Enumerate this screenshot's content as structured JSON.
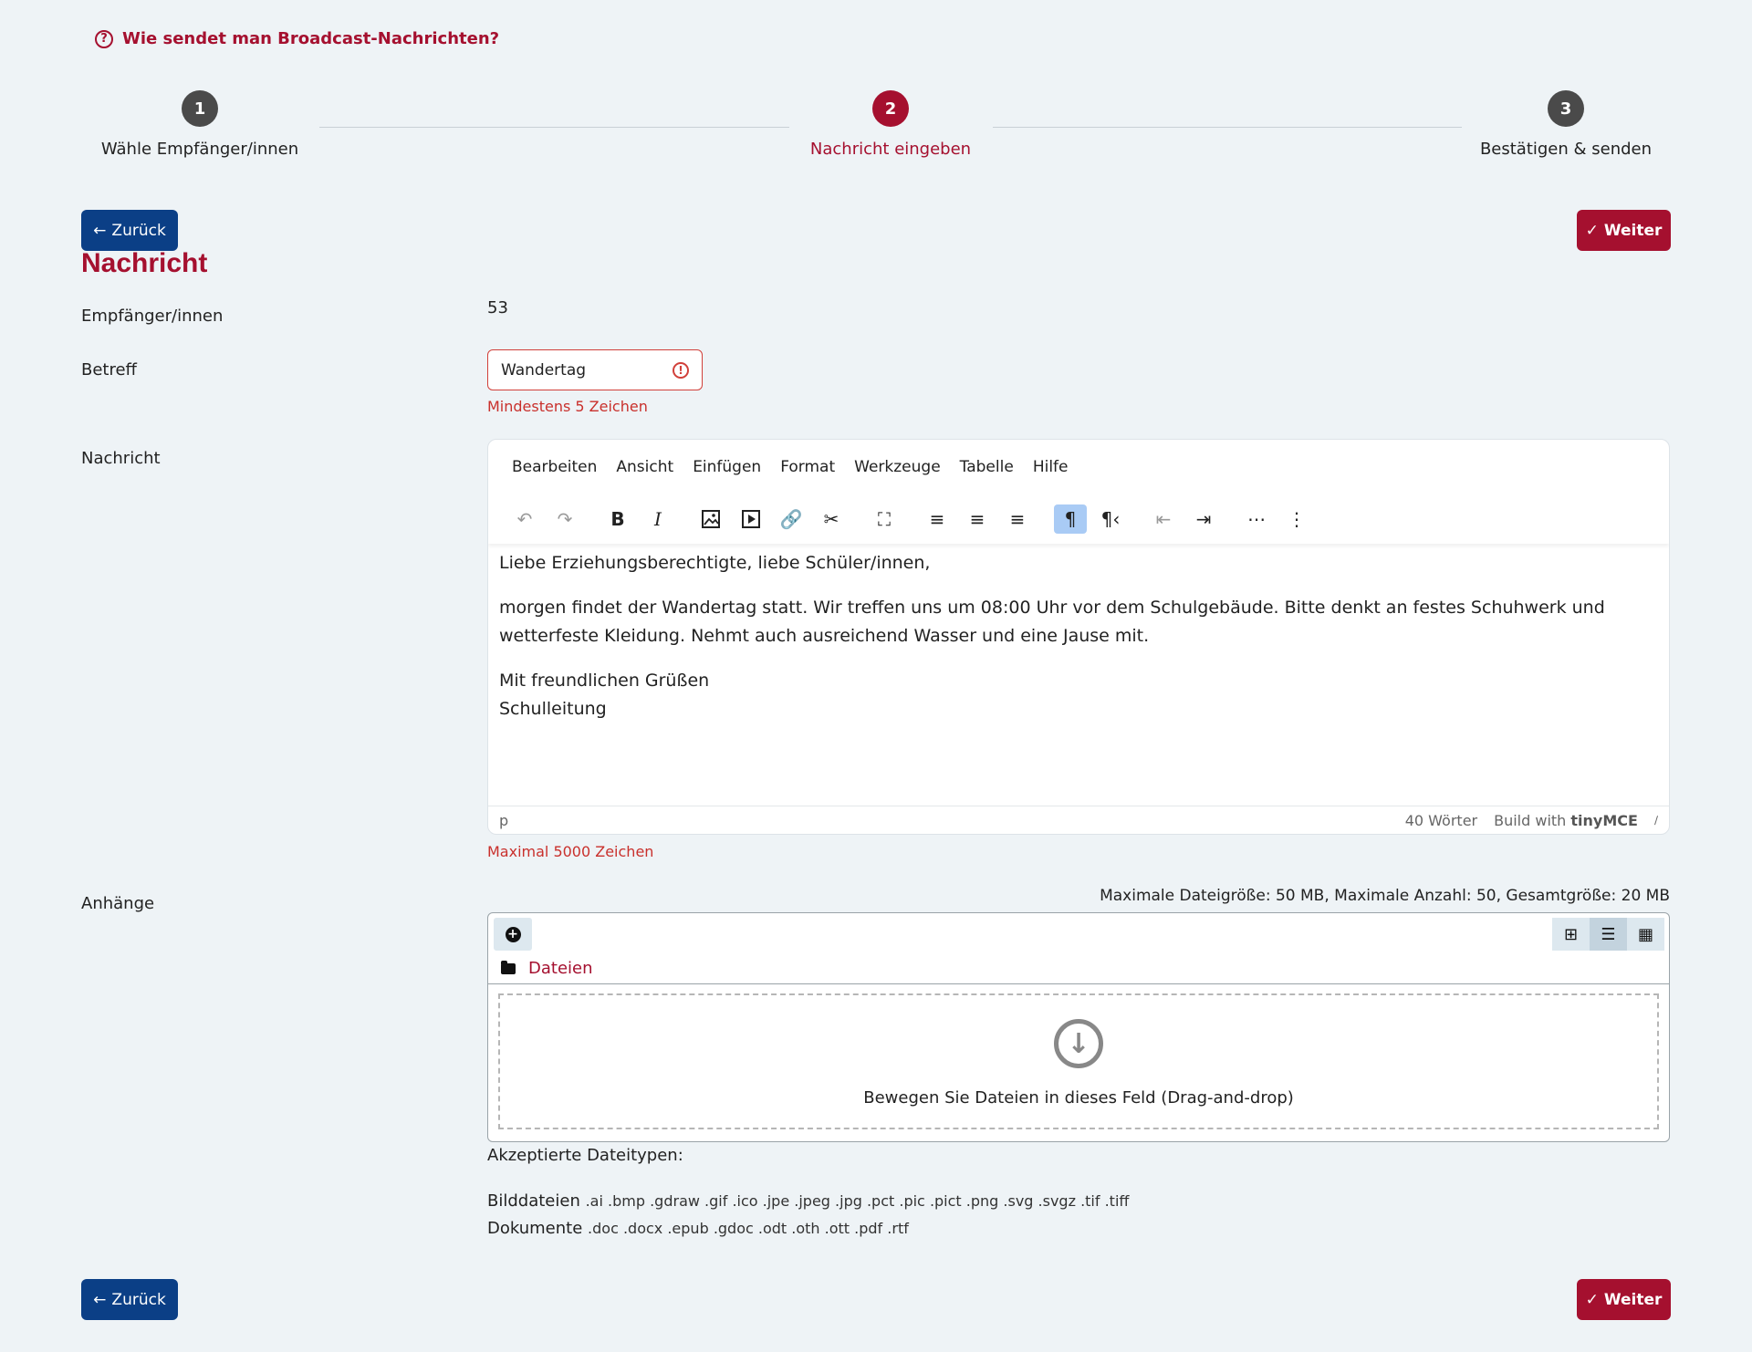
{
  "help_link": "Wie sendet man Broadcast-Nachrichten?",
  "steps": [
    {
      "number": "1",
      "label": "Wähle Empfänger/innen"
    },
    {
      "number": "2",
      "label": "Nachricht eingeben"
    },
    {
      "number": "3",
      "label": "Bestätigen & senden"
    }
  ],
  "nav": {
    "back_label": "Zurück",
    "next_label": "Weiter"
  },
  "page_title": "Nachricht",
  "recipients": {
    "label": "Empfänger/innen",
    "count": "53"
  },
  "subject": {
    "label": "Betreff",
    "value": "Wandertag",
    "error": "Mindestens 5 Zeichen"
  },
  "message": {
    "label": "Nachricht",
    "menu": [
      "Bearbeiten",
      "Ansicht",
      "Einfügen",
      "Format",
      "Werkzeuge",
      "Tabelle",
      "Hilfe"
    ],
    "paragraph1": "Liebe Erziehungsberechtigte, liebe Schüler/innen,",
    "paragraph2": "morgen findet der Wandertag statt. Wir treffen uns um 08:00 Uhr vor dem Schulgebäude. Bitte denkt an festes Schuhwerk und wetterfeste Kleidung. Nehmt auch ausreichend Wasser und eine Jause mit.",
    "closing": "Mit freundlichen Grüßen",
    "signature": "Schulleitung",
    "status_path": "p",
    "word_count": "40 Wörter",
    "build_with": "Build with",
    "tiny_brand": "tinyMCE",
    "max_chars": "Maximal 5000 Zeichen"
  },
  "attachments": {
    "label": "Anhänge",
    "limits": "Maximale Dateigröße: 50 MB, Maximale Anzahl: 50, Gesamtgröße: 20 MB",
    "folder": "Dateien",
    "drop_text": "Bewegen Sie Dateien in dieses Feld (Drag-and-drop)",
    "accepted_title": "Akzeptierte Dateitypen:",
    "image_label": "Bilddateien",
    "image_types": ".ai .bmp .gdraw .gif .ico .jpe .jpeg .jpg .pct .pic .pict .png .svg .svgz .tif .tiff",
    "doc_label": "Dokumente",
    "doc_types": ".doc .docx .epub .gdoc .odt .oth .ott .pdf .rtf"
  },
  "colors": {
    "accent": "#a5102f",
    "primary": "#0b3f86",
    "error": "#c9302c",
    "background": "#eef3f6"
  }
}
